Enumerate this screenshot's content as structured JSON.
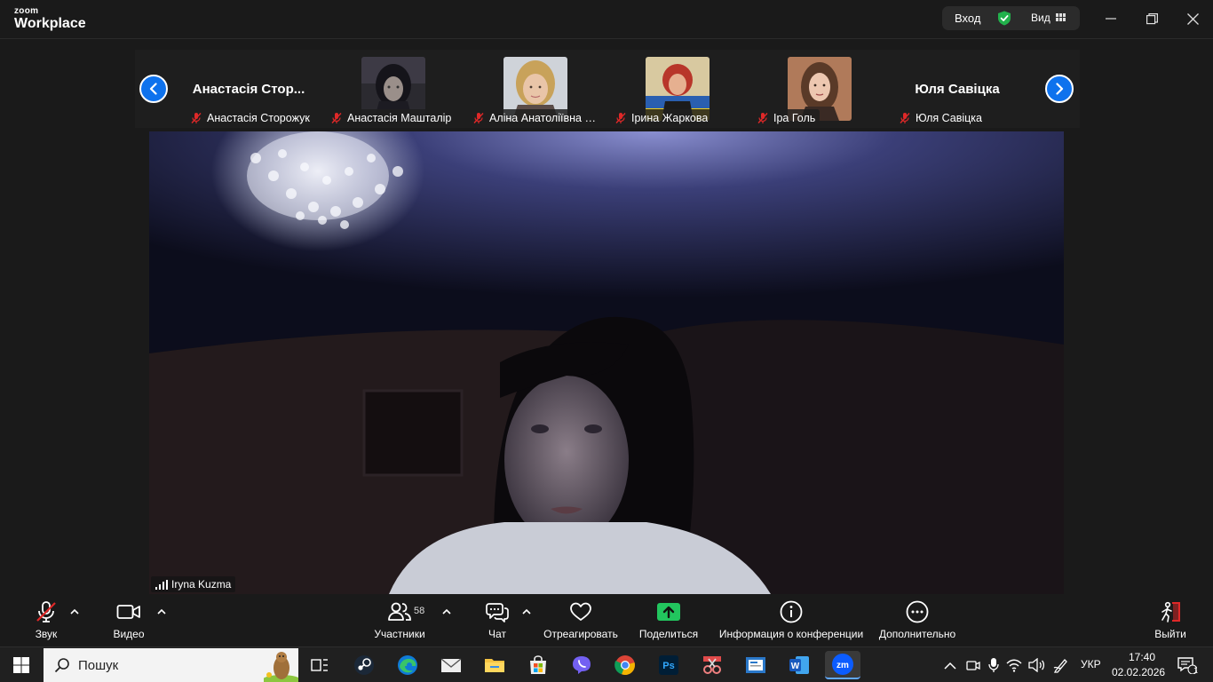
{
  "window": {
    "brand_top": "zoom",
    "brand_bottom": "Workplace",
    "login_label": "Вход",
    "view_label": "Вид",
    "security_icon": "green-shield-check-icon",
    "controls": [
      "minimize-icon",
      "restore-icon",
      "close-icon"
    ]
  },
  "strip": {
    "participants": [
      {
        "big_name": "Анастасія Стор...",
        "name": "Анастасія Сторожук",
        "muted": true,
        "has_video": false
      },
      {
        "name": "Анастасія Машталір",
        "muted": true,
        "has_video": true
      },
      {
        "name": "Аліна Анатоліївна Пр...",
        "muted": true,
        "has_video": true
      },
      {
        "name": "Ірина Жаркова",
        "muted": true,
        "has_video": true
      },
      {
        "name": "Іра Голь",
        "muted": true,
        "has_video": true
      },
      {
        "big_name": "Юля Савіцка",
        "name": "Юля Савіцка",
        "muted": true,
        "has_video": false
      }
    ]
  },
  "main_video": {
    "speaker_name": "Iryna Kuzma"
  },
  "toolbar": {
    "audio_label": "Звук",
    "video_label": "Видео",
    "participants_label": "Участники",
    "participants_count": "58",
    "chat_label": "Чат",
    "react_label": "Отреагировать",
    "share_label": "Поделиться",
    "info_label": "Информация о конференции",
    "more_label": "Дополнительно",
    "leave_label": "Выйти",
    "colors": {
      "share_green": "#22c55e",
      "mute_red": "#e02828",
      "accent_blue": "#0e72ed"
    }
  },
  "taskbar": {
    "search_placeholder": "Пошук",
    "language": "УКР",
    "time": "17:40",
    "date": "02.02.2026",
    "notifications": "1"
  }
}
